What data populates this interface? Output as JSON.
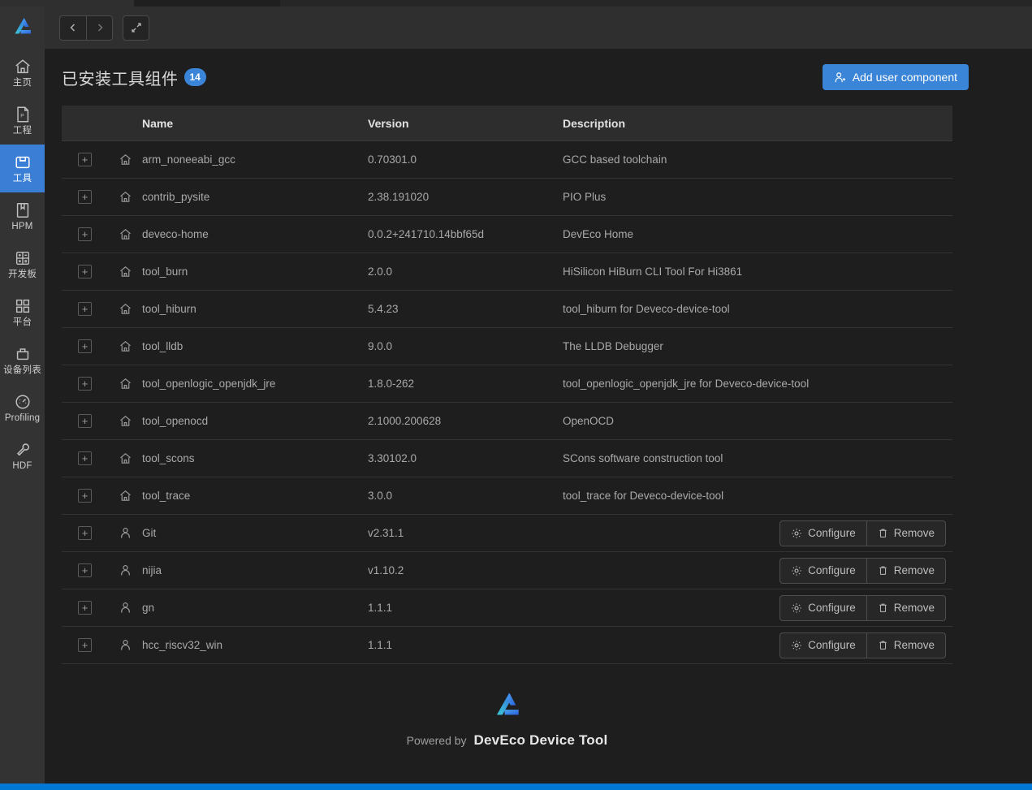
{
  "app": {
    "logo_name": "deveco-logo"
  },
  "toolbar": {
    "back_label": "‹",
    "forward_label": "›",
    "expand_label": "expand-icon"
  },
  "sidebar": {
    "items": [
      {
        "label": "主页",
        "icon": "home-icon",
        "active": false
      },
      {
        "label": "工程",
        "icon": "project-icon",
        "active": false
      },
      {
        "label": "工具",
        "icon": "tools-icon",
        "active": true
      },
      {
        "label": "HPM",
        "icon": "book-icon",
        "active": false
      },
      {
        "label": "开发板",
        "icon": "board-icon",
        "active": false
      },
      {
        "label": "平台",
        "icon": "grid-icon",
        "active": false
      },
      {
        "label": "设备列表",
        "icon": "device-icon",
        "active": false
      },
      {
        "label": "Profiling",
        "icon": "gauge-icon",
        "active": false
      },
      {
        "label": "HDF",
        "icon": "wrench-icon",
        "active": false
      }
    ]
  },
  "page": {
    "title": "已安装工具组件",
    "count": "14",
    "add_button": "Add user component",
    "add_button_icon": "user-plus-icon"
  },
  "table": {
    "columns": [
      "Name",
      "Version",
      "Description"
    ],
    "expand_glyph": "+",
    "rows": [
      {
        "type": "system",
        "name": "arm_noneeabi_gcc",
        "version": "0.70301.0",
        "description": "GCC based toolchain",
        "actions": []
      },
      {
        "type": "system",
        "name": "contrib_pysite",
        "version": "2.38.191020",
        "description": "PIO Plus",
        "actions": []
      },
      {
        "type": "system",
        "name": "deveco-home",
        "version": "0.0.2+241710.14bbf65d",
        "description": "DevEco Home",
        "actions": []
      },
      {
        "type": "system",
        "name": "tool_burn",
        "version": "2.0.0",
        "description": "HiSilicon HiBurn CLI Tool For Hi3861",
        "actions": []
      },
      {
        "type": "system",
        "name": "tool_hiburn",
        "version": "5.4.23",
        "description": "tool_hiburn for Deveco-device-tool",
        "actions": []
      },
      {
        "type": "system",
        "name": "tool_lldb",
        "version": "9.0.0",
        "description": "The LLDB Debugger",
        "actions": []
      },
      {
        "type": "system",
        "name": "tool_openlogic_openjdk_jre",
        "version": "1.8.0-262",
        "description": "tool_openlogic_openjdk_jre for Deveco-device-tool",
        "actions": []
      },
      {
        "type": "system",
        "name": "tool_openocd",
        "version": "2.1000.200628",
        "description": "OpenOCD",
        "actions": []
      },
      {
        "type": "system",
        "name": "tool_scons",
        "version": "3.30102.0",
        "description": "SCons software construction tool",
        "actions": []
      },
      {
        "type": "system",
        "name": "tool_trace",
        "version": "3.0.0",
        "description": "tool_trace for Deveco-device-tool",
        "actions": []
      },
      {
        "type": "user",
        "name": "Git",
        "version": "v2.31.1",
        "description": "",
        "actions": [
          "Configure",
          "Remove"
        ]
      },
      {
        "type": "user",
        "name": "nijia",
        "version": "v1.10.2",
        "description": "",
        "actions": [
          "Configure",
          "Remove"
        ]
      },
      {
        "type": "user",
        "name": "gn",
        "version": "1.1.1",
        "description": "",
        "actions": [
          "Configure",
          "Remove"
        ]
      },
      {
        "type": "user",
        "name": "hcc_riscv32_win",
        "version": "1.1.1",
        "description": "",
        "actions": [
          "Configure",
          "Remove"
        ]
      }
    ],
    "action_icons": {
      "Configure": "gear-icon",
      "Remove": "trash-icon"
    }
  },
  "footer": {
    "powered_by": "Powered by",
    "brand": "DevEco Device Tool",
    "logo": "deveco-logo"
  },
  "colors": {
    "accent": "#3a85d8",
    "sidebar_active": "#3a7fd5",
    "background": "#1e1e1e",
    "sidebar_bg": "#333333",
    "table_header_bg": "#2d2d2d",
    "statusbar": "#0078d4"
  }
}
